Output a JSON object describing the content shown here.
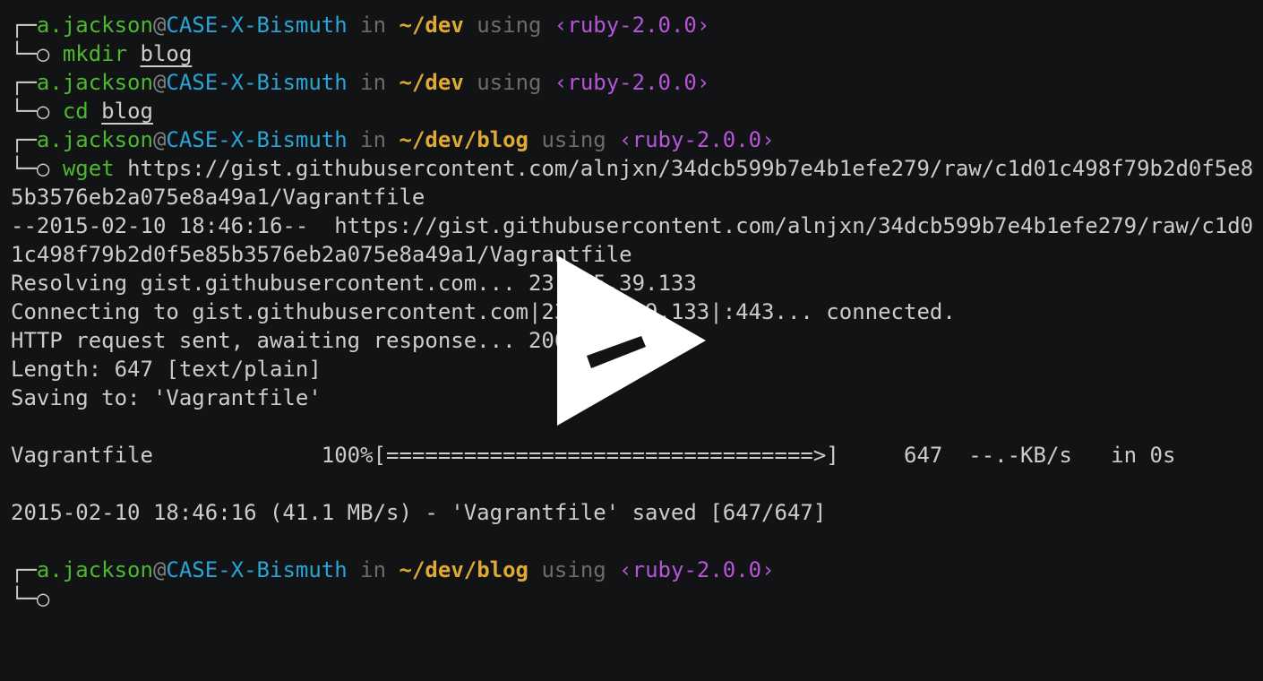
{
  "prompt": {
    "user": "a.jackson",
    "at": "@",
    "host": "CASE-X-Bismuth",
    "in_word": "in",
    "using_word": "using",
    "ruby": "‹ruby-2.0.0›",
    "top_corner": "┌─",
    "bottom_corner": "└─○"
  },
  "blocks": [
    {
      "path": "~/dev",
      "command": "mkdir",
      "argument": "blog"
    },
    {
      "path": "~/dev",
      "command": "cd",
      "argument": "blog"
    },
    {
      "path": "~/dev/blog",
      "command": "wget",
      "argument": "https://gist.githubusercontent.com/alnjxn/34dcb599b7e4b1efe279/raw/c1d01c498f79b2d0f5e8",
      "argument_continued": "5b3576eb2a075e8a49a1/Vagrantfile"
    }
  ],
  "output": [
    "--2015-02-10 18:46:16--  https://gist.githubusercontent.com/alnjxn/34dcb599b7e4b1efe279/raw/c1d0",
    "1c498f79b2d0f5e85b3576eb2a075e8a49a1/Vagrantfile",
    "Resolving gist.githubusercontent.com... 23.235.39.133",
    "Connecting to gist.githubusercontent.com|23.235.39.133|:443... connected.",
    "HTTP request sent, awaiting response... 200 OK",
    "Length: 647 [text/plain]",
    "Saving to: 'Vagrantfile'",
    "",
    "Vagrantfile             100%[=================================>]     647  --.-KB/s   in 0s",
    "",
    "2015-02-10 18:46:16 (41.1 MB/s) - 'Vagrantfile' saved [647/647]",
    ""
  ],
  "final_prompt": {
    "path": "~/dev/blog"
  },
  "player": {
    "icon": "play-icon",
    "overlay_color": "#ffffff"
  }
}
